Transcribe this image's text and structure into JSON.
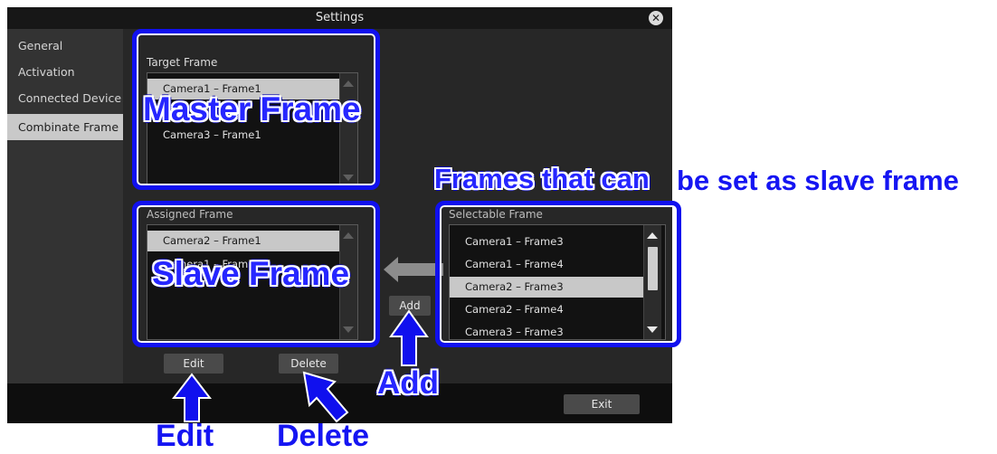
{
  "window": {
    "title": "Settings",
    "close_icon": "close-icon",
    "close_glyph": "✕"
  },
  "sidebar": {
    "items": [
      {
        "label": "General"
      },
      {
        "label": "Activation"
      },
      {
        "label": "Connected Device"
      },
      {
        "label": "Combinate Frame",
        "active": true
      }
    ]
  },
  "target_frame": {
    "label": "Target Frame",
    "items": [
      "Camera1 – Frame1",
      "Camera3 – Frame1"
    ],
    "selected": "Camera1 – Frame1"
  },
  "assigned_frame": {
    "label": "Assigned Frame",
    "items": [
      "Camera2 – Frame1",
      "Camera1 – Frame2"
    ],
    "selected": "Camera2 – Frame1"
  },
  "selectable_frame": {
    "label": "Selectable Frame",
    "items": [
      "Camera1 – Frame3",
      "Camera1 – Frame4",
      "Camera2 – Frame3",
      "Camera2 – Frame4",
      "Camera3 – Frame3"
    ],
    "selected": "Camera2 – Frame3"
  },
  "buttons": {
    "add": "Add",
    "edit": "Edit",
    "delete": "Delete",
    "exit": "Exit"
  },
  "annotations": {
    "master_frame": "Master Frame",
    "slave_frame": "Slave Frame",
    "selectable_caption_styled": "Frames that can",
    "selectable_caption_plain": "be set as slave frame",
    "add": "Add",
    "edit": "Edit",
    "delete": "Delete"
  },
  "colors": {
    "annotation_blue": "#1010ee",
    "selection_gray": "#c8c8c8",
    "dialog_bg": "#2b2b2b"
  }
}
